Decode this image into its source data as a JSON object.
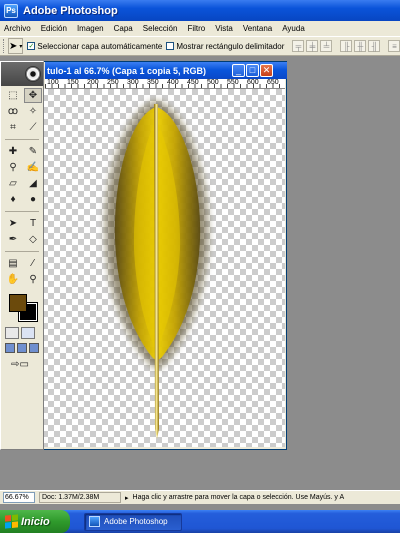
{
  "app": {
    "title": "Adobe Photoshop",
    "icon": "photoshop-icon"
  },
  "menu": [
    "Archivo",
    "Edición",
    "Imagen",
    "Capa",
    "Selección",
    "Filtro",
    "Vista",
    "Ventana",
    "Ayuda"
  ],
  "options": {
    "auto_select_label": "Seleccionar capa automáticamente",
    "auto_select_checked": true,
    "bounding_box_label": "Mostrar rectángulo delimitador",
    "bounding_box_checked": false
  },
  "document": {
    "title": "tulo-1 al 66.7% (Capa 1 copia 5, RGB)",
    "ruler_top": [
      "100",
      "150",
      "200",
      "250",
      "300",
      "350",
      "400",
      "450",
      "500",
      "550",
      "600",
      "650"
    ],
    "ruler_left": [
      "600",
      "650",
      "700",
      "750"
    ]
  },
  "colors": {
    "foreground": "#6b4a0c",
    "background": "#000000",
    "feather": "#d4b400"
  },
  "status": {
    "zoom": "66.67%",
    "doc_info": "Doc: 1.37M/2.38M",
    "hint": "Haga clic y arrastre para mover la capa o selección. Use Mayús. y A"
  },
  "taskbar": {
    "start_label": "Inicio",
    "task_label": "Adobe Photoshop"
  }
}
